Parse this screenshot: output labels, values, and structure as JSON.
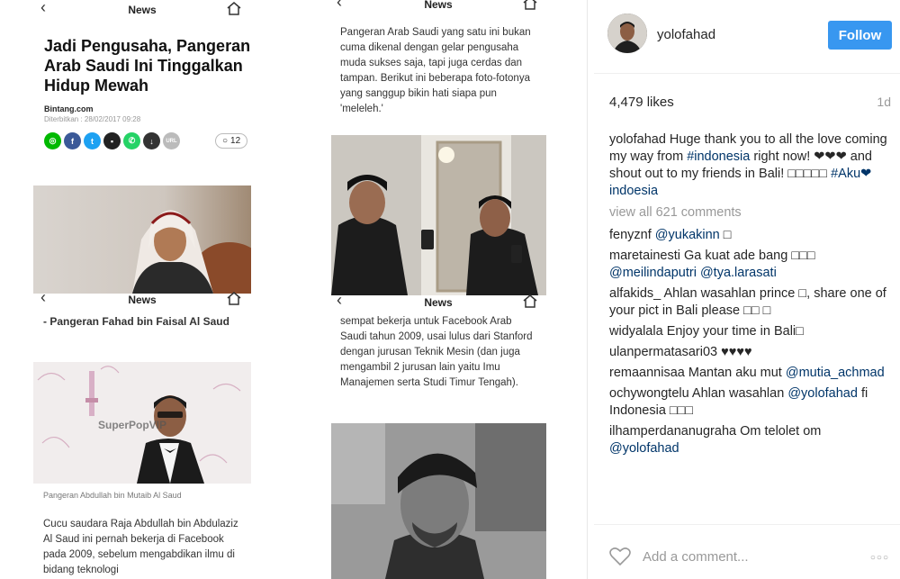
{
  "article": {
    "nav_title": "News",
    "headline": "Jadi Pengusaha, Pangeran Arab Saudi Ini Tinggalkan Hidup Mewah",
    "source": "Bintang.com",
    "published": "Diterbitkan : 28/02/2017 09:28",
    "comment_count": "12",
    "share_icons": [
      "line-icon",
      "facebook-icon",
      "twitter-icon",
      "bbm-icon",
      "whatsapp-icon",
      "download-icon",
      "url-icon"
    ],
    "url_label": "URL",
    "section2_text": "- Pangeran Fahad bin Faisal Al Saud",
    "photo_caption": "Pangeran Abdullah bin Mutaib Al Saud",
    "photo_watermark": "SuperPopVIP",
    "section2_body": "Cucu saudara Raja Abdullah bin Abdulaziz Al Saud ini pernah bekerja di Facebook pada 2009, sebelum mengabdikan ilmu di bidang teknologi",
    "col2_intro": "Pangeran Arab Saudi yang satu ini bukan cuma dikenal dengan gelar pengusaha muda sukses saja, tapi juga cerdas dan tampan. Berikut ini beberapa foto-fotonya yang sanggup bikin hati siapa pun 'meleleh.'",
    "col2_body": "sempat bekerja untuk Facebook Arab Saudi tahun 2009, usai lulus dari Stanford dengan jurusan Teknik Mesin (dan juga mengambil 2 jurusan lain yaitu Imu Manajemen serta Studi Timur Tengah)."
  },
  "instagram": {
    "username": "yolofahad",
    "follow_label": "Follow",
    "likes": "4,479 likes",
    "age": "1d",
    "caption": {
      "user": "yolofahad",
      "parts": [
        "Huge thank you to all the love coming my way from ",
        "#indonesia",
        " right now! ❤❤❤ and shout out to my friends in Bali! □□□□□ ",
        "#Aku❤indoesia"
      ]
    },
    "view_all": "view all 621 comments",
    "comments": [
      {
        "user": "fenyznf",
        "text": "",
        "mention": "@yukakinn",
        "tail": " □"
      },
      {
        "user": "maretainesti",
        "text": "Ga kuat ade bang □□□ ",
        "mention": "@meilindaputri @tya.larasati",
        "tail": ""
      },
      {
        "user": "alfakids_",
        "text": "Ahlan wasahlan prince □, share one of your pict in Bali please □□ □",
        "mention": "",
        "tail": ""
      },
      {
        "user": "widyalala",
        "text": "Enjoy your time in Bali□",
        "mention": "",
        "tail": ""
      },
      {
        "user": "ulanpermatasari03",
        "text": "♥♥♥♥",
        "mention": "",
        "tail": ""
      },
      {
        "user": "remaannisaa",
        "text": "Mantan aku mut ",
        "mention": "@mutia_achmad",
        "tail": ""
      },
      {
        "user": "ochywongtelu",
        "text": "Ahlan wasahlan ",
        "mention": "@yolofahad",
        "tail": " fi Indonesia □□□"
      },
      {
        "user": "ilhamperdananugraha",
        "text": "Om telolet om ",
        "mention": "@yolofahad",
        "tail": ""
      }
    ],
    "add_comment_placeholder": "Add a comment...",
    "more_label": "○○○"
  },
  "colors": {
    "follow_blue": "#3897f0",
    "hashtag": "#003569",
    "line_green": "#00b900",
    "facebook_blue": "#3b5998",
    "twitter_blue": "#1da1f2",
    "bbm_dark": "#222222",
    "whatsapp_green": "#25d366"
  }
}
